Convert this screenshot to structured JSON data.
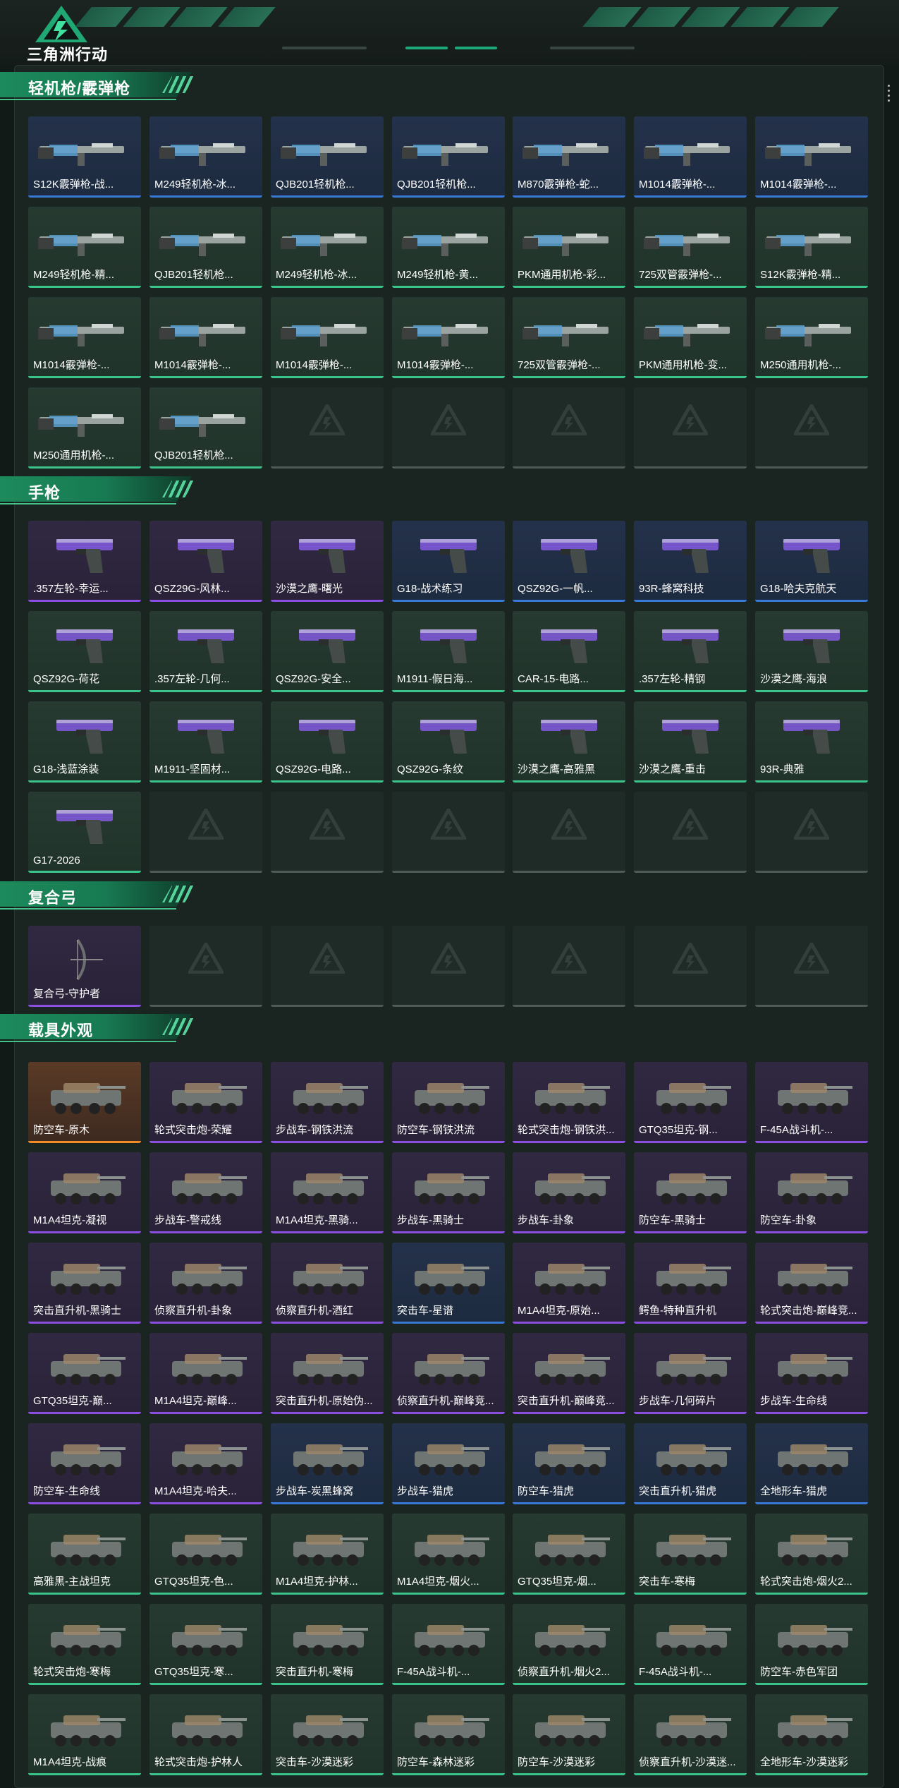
{
  "header": {
    "brand": "三角洲行动"
  },
  "colors": {
    "green": "#3ac48b",
    "blue": "#3a78d8",
    "purple": "#8a4fe0",
    "orange": "#f08a24",
    "empty": "#4d5a55"
  },
  "sections": [
    {
      "title": "轻机枪/霰弹枪",
      "kind": "gun",
      "items": [
        {
          "label": "S12K霰弹枪-战...",
          "rarity": "blue"
        },
        {
          "label": "M249轻机枪-冰...",
          "rarity": "blue"
        },
        {
          "label": "QJB201轻机枪...",
          "rarity": "blue"
        },
        {
          "label": "QJB201轻机枪...",
          "rarity": "blue"
        },
        {
          "label": "M870霰弹枪-蛇...",
          "rarity": "blue"
        },
        {
          "label": "M1014霰弹枪-...",
          "rarity": "blue"
        },
        {
          "label": "M1014霰弹枪-...",
          "rarity": "blue"
        },
        {
          "label": "M249轻机枪-精...",
          "rarity": "green"
        },
        {
          "label": "QJB201轻机枪...",
          "rarity": "green"
        },
        {
          "label": "M249轻机枪-冰...",
          "rarity": "green"
        },
        {
          "label": "M249轻机枪-黄...",
          "rarity": "green"
        },
        {
          "label": "PKM通用机枪-彩...",
          "rarity": "green"
        },
        {
          "label": "725双管霰弹枪-...",
          "rarity": "green"
        },
        {
          "label": "S12K霰弹枪-精...",
          "rarity": "green"
        },
        {
          "label": "M1014霰弹枪-...",
          "rarity": "green"
        },
        {
          "label": "M1014霰弹枪-...",
          "rarity": "green"
        },
        {
          "label": "M1014霰弹枪-...",
          "rarity": "green"
        },
        {
          "label": "M1014霰弹枪-...",
          "rarity": "green"
        },
        {
          "label": "725双管霰弹枪-...",
          "rarity": "green"
        },
        {
          "label": "PKM通用机枪-变...",
          "rarity": "green"
        },
        {
          "label": "M250通用机枪-...",
          "rarity": "green"
        },
        {
          "label": "M250通用机枪-...",
          "rarity": "green"
        },
        {
          "label": "QJB201轻机枪...",
          "rarity": "green"
        },
        {
          "label": "",
          "rarity": "empty"
        },
        {
          "label": "",
          "rarity": "empty"
        },
        {
          "label": "",
          "rarity": "empty"
        },
        {
          "label": "",
          "rarity": "empty"
        },
        {
          "label": "",
          "rarity": "empty"
        }
      ]
    },
    {
      "title": "手枪",
      "kind": "pistol",
      "items": [
        {
          "label": ".357左轮-幸运...",
          "rarity": "purple"
        },
        {
          "label": "QSZ29G-风林...",
          "rarity": "purple"
        },
        {
          "label": "沙漠之鹰-曙光",
          "rarity": "purple"
        },
        {
          "label": "G18-战术练习",
          "rarity": "blue"
        },
        {
          "label": "QSZ92G-一帆...",
          "rarity": "blue"
        },
        {
          "label": "93R-蜂窝科技",
          "rarity": "blue"
        },
        {
          "label": "G18-哈夫克航天",
          "rarity": "blue"
        },
        {
          "label": "QSZ92G-荷花",
          "rarity": "green"
        },
        {
          "label": ".357左轮-几何...",
          "rarity": "green"
        },
        {
          "label": "QSZ92G-安全...",
          "rarity": "green"
        },
        {
          "label": "M1911-假日海...",
          "rarity": "green"
        },
        {
          "label": "CAR-15-电路...",
          "rarity": "green"
        },
        {
          "label": ".357左轮-精钢",
          "rarity": "green"
        },
        {
          "label": "沙漠之鹰-海浪",
          "rarity": "green"
        },
        {
          "label": "G18-浅蓝涂装",
          "rarity": "green"
        },
        {
          "label": "M1911-坚固材...",
          "rarity": "green"
        },
        {
          "label": "QSZ92G-电路...",
          "rarity": "green"
        },
        {
          "label": "QSZ92G-条纹",
          "rarity": "green"
        },
        {
          "label": "沙漠之鹰-高雅黑",
          "rarity": "green"
        },
        {
          "label": "沙漠之鹰-重击",
          "rarity": "green"
        },
        {
          "label": "93R-典雅",
          "rarity": "green"
        },
        {
          "label": "G17-2026",
          "rarity": "green"
        },
        {
          "label": "",
          "rarity": "empty"
        },
        {
          "label": "",
          "rarity": "empty"
        },
        {
          "label": "",
          "rarity": "empty"
        },
        {
          "label": "",
          "rarity": "empty"
        },
        {
          "label": "",
          "rarity": "empty"
        },
        {
          "label": "",
          "rarity": "empty"
        }
      ]
    },
    {
      "title": "复合弓",
      "kind": "bow",
      "items": [
        {
          "label": "复合弓-守护者",
          "rarity": "purple"
        },
        {
          "label": "",
          "rarity": "empty"
        },
        {
          "label": "",
          "rarity": "empty"
        },
        {
          "label": "",
          "rarity": "empty"
        },
        {
          "label": "",
          "rarity": "empty"
        },
        {
          "label": "",
          "rarity": "empty"
        },
        {
          "label": "",
          "rarity": "empty"
        }
      ]
    },
    {
      "title": "载具外观",
      "kind": "vehicle",
      "items": [
        {
          "label": "防空车-原木",
          "rarity": "orange"
        },
        {
          "label": "轮式突击炮-荣耀",
          "rarity": "purple"
        },
        {
          "label": "步战车-钢铁洪流",
          "rarity": "purple"
        },
        {
          "label": "防空车-钢铁洪流",
          "rarity": "purple"
        },
        {
          "label": "轮式突击炮-钢铁洪...",
          "rarity": "purple"
        },
        {
          "label": "GTQ35坦克-钢...",
          "rarity": "purple"
        },
        {
          "label": "F-45A战斗机-...",
          "rarity": "purple"
        },
        {
          "label": "M1A4坦克-凝视",
          "rarity": "purple"
        },
        {
          "label": "步战车-警戒线",
          "rarity": "purple"
        },
        {
          "label": "M1A4坦克-黑骑...",
          "rarity": "purple"
        },
        {
          "label": "步战车-黑骑士",
          "rarity": "purple"
        },
        {
          "label": "步战车-卦象",
          "rarity": "purple"
        },
        {
          "label": "防空车-黑骑士",
          "rarity": "purple"
        },
        {
          "label": "防空车-卦象",
          "rarity": "purple"
        },
        {
          "label": "突击直升机-黑骑士",
          "rarity": "purple"
        },
        {
          "label": "侦察直升机-卦象",
          "rarity": "purple"
        },
        {
          "label": "侦察直升机-酒红",
          "rarity": "purple"
        },
        {
          "label": "突击车-星谱",
          "rarity": "blue"
        },
        {
          "label": "M1A4坦克-原始...",
          "rarity": "purple"
        },
        {
          "label": "鳄鱼-特种直升机",
          "rarity": "purple"
        },
        {
          "label": "轮式突击炮-巅峰竞...",
          "rarity": "purple"
        },
        {
          "label": "GTQ35坦克-巅...",
          "rarity": "purple"
        },
        {
          "label": "M1A4坦克-巅峰...",
          "rarity": "purple"
        },
        {
          "label": "突击直升机-原始伪...",
          "rarity": "purple"
        },
        {
          "label": "侦察直升机-巅峰竞...",
          "rarity": "purple"
        },
        {
          "label": "突击直升机-巅峰竞...",
          "rarity": "purple"
        },
        {
          "label": "步战车-几何碎片",
          "rarity": "purple"
        },
        {
          "label": "步战车-生命线",
          "rarity": "purple"
        },
        {
          "label": "防空车-生命线",
          "rarity": "purple"
        },
        {
          "label": "M1A4坦克-哈夫...",
          "rarity": "purple"
        },
        {
          "label": "步战车-炭黑蜂窝",
          "rarity": "blue"
        },
        {
          "label": "步战车-猎虎",
          "rarity": "blue"
        },
        {
          "label": "防空车-猎虎",
          "rarity": "blue"
        },
        {
          "label": "突击直升机-猎虎",
          "rarity": "blue"
        },
        {
          "label": "全地形车-猎虎",
          "rarity": "blue"
        },
        {
          "label": "高雅黑-主战坦克",
          "rarity": "green"
        },
        {
          "label": "GTQ35坦克-色...",
          "rarity": "green"
        },
        {
          "label": "M1A4坦克-护林...",
          "rarity": "green"
        },
        {
          "label": "M1A4坦克-烟火...",
          "rarity": "green"
        },
        {
          "label": "GTQ35坦克-烟...",
          "rarity": "green"
        },
        {
          "label": "突击车-寒梅",
          "rarity": "green"
        },
        {
          "label": "轮式突击炮-烟火2...",
          "rarity": "green"
        },
        {
          "label": "轮式突击炮-寒梅",
          "rarity": "green"
        },
        {
          "label": "GTQ35坦克-寒...",
          "rarity": "green"
        },
        {
          "label": "突击直升机-寒梅",
          "rarity": "green"
        },
        {
          "label": "F-45A战斗机-...",
          "rarity": "green"
        },
        {
          "label": "侦察直升机-烟火2...",
          "rarity": "green"
        },
        {
          "label": "F-45A战斗机-...",
          "rarity": "green"
        },
        {
          "label": "防空车-赤色军团",
          "rarity": "green"
        },
        {
          "label": "M1A4坦克-战痕",
          "rarity": "green"
        },
        {
          "label": "轮式突击炮-护林人",
          "rarity": "green"
        },
        {
          "label": "突击车-沙漠迷彩",
          "rarity": "green"
        },
        {
          "label": "防空车-森林迷彩",
          "rarity": "green"
        },
        {
          "label": "防空车-沙漠迷彩",
          "rarity": "green"
        },
        {
          "label": "侦察直升机-沙漠迷...",
          "rarity": "green"
        },
        {
          "label": "全地形车-沙漠迷彩",
          "rarity": "green"
        }
      ]
    }
  ]
}
